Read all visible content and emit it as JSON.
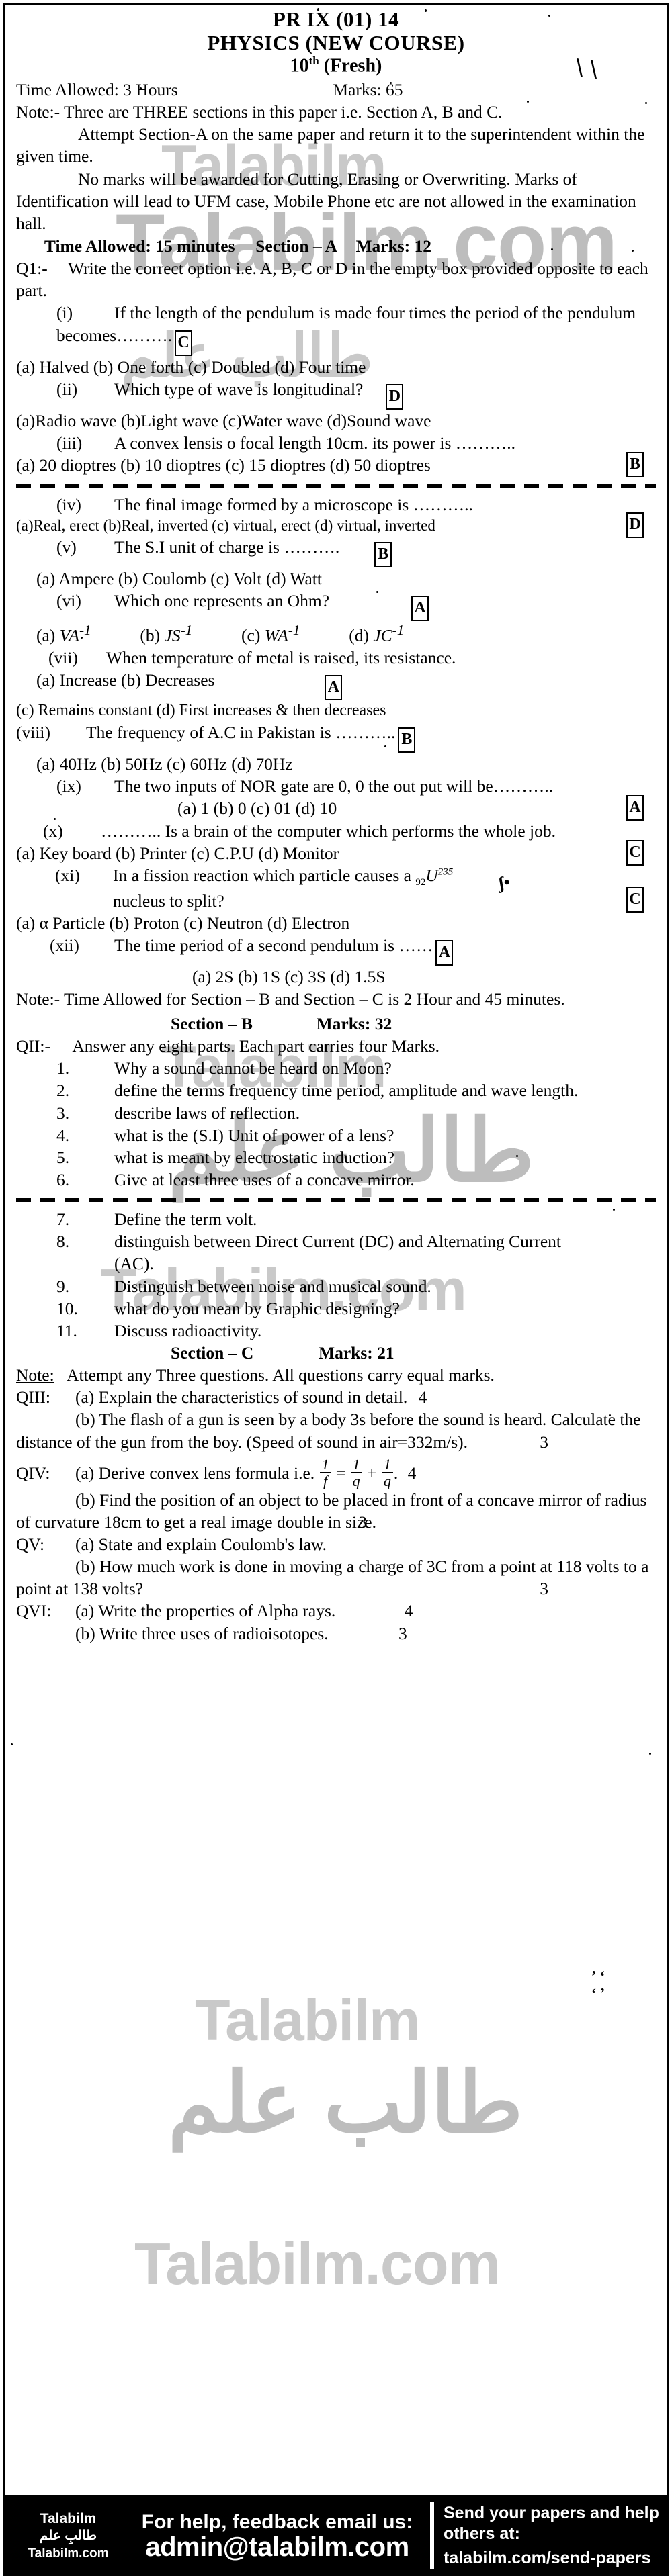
{
  "header": {
    "code": "PR IX (01) 14",
    "subject": "PHYSICS (NEW COURSE)",
    "class_num": "10",
    "class_sup": "th",
    "class_suffix": "(Fresh)",
    "hand_mark": "\\ \\",
    "time_allowed": "Time Allowed: 3 Hours",
    "marks": "Marks: 65"
  },
  "notes": {
    "note1": "Note:- Three are THREE sections in this paper i.e. Section A, B and C.",
    "para1": "Attempt Section-A on the same paper and return it to the superintendent within the given time.",
    "para2": "No marks will be awarded for Cutting, Erasing or Overwriting. Marks of Identification will lead to UFM case, Mobile Phone etc are not allowed in the examination hall."
  },
  "section_a": {
    "time_allowed": "Time Allowed: 15 minutes",
    "title": "Section – A",
    "marks": "Marks: 12",
    "q1_label": "Q1:-",
    "q1_text": "Write the correct option i.e. A, B, C or D in the empty box provided opposite to each part.",
    "mcqs": [
      {
        "num": "(i)",
        "stem": "If the length of the pendulum is made four times the period of the pendulum becomes……….",
        "answer": "C",
        "options": "(a) Halved        (b) One forth  (c) Doubled     (d) Four time"
      },
      {
        "num": "(ii)",
        "stem": "Which type of wave is longitudinal?",
        "answer": "D",
        "options": "(a)Radio wave (b)Light wave (c)Water wave (d)Sound wave"
      },
      {
        "num": "(iii)",
        "stem": "A convex lensis o focal length 10cm. its power is ………..",
        "answer": "B",
        "options": "(a) 20 dioptres (b) 10 dioptres  (c) 15 dioptres  (d) 50 dioptres"
      },
      {
        "num": "(iv)",
        "stem": "The final image formed by a microscope is ………..",
        "answer": "D",
        "options": "(a)Real, erect  (b)Real, inverted  (c) virtual, erect (d) virtual, inverted"
      },
      {
        "num": "(v)",
        "stem": "The S.I unit of charge is ……….",
        "answer": "B",
        "options": "(a) Ampere     (b) Coulomb   (c) Volt          (d) Watt"
      },
      {
        "num": "(vi)",
        "stem": "Which one represents an Ohm?",
        "answer": "A",
        "options_math": true
      },
      {
        "num": "(vii)",
        "stem": "When temperature of metal is raised, its resistance.",
        "answer": "A",
        "options": "(a) Increase          (b) Decreases",
        "options2": "(c) Remains constant  (d) First increases & then decreases"
      },
      {
        "num": "(viii)",
        "stem": "The frequency of A.C in Pakistan is ………..",
        "answer": "B",
        "options": "(a) 40Hz       (b) 50Hz       (c) 60Hz        (d) 70Hz"
      },
      {
        "num": "(ix)",
        "stem": "The two inputs of NOR gate are 0, 0 the out put will be………..",
        "answer": "A",
        "options": "(a) 1   (b) 0   (c) 01  (d) 10"
      },
      {
        "num": "(x)",
        "stem": "……….. Is a brain of the computer which performs the whole job.",
        "answer": "C",
        "options": "(a) Key board (b) Printer      (c) C.P.U        (d) Monitor"
      },
      {
        "num": "(xi)",
        "stem": "In a fission reaction which particle causes a",
        "stem_tail": "nucleus to split?",
        "answer": "C",
        "options": "(a) α  Particle (b) Proton      (c) Neutron     (d) Electron"
      },
      {
        "num": "(xii)",
        "stem": "The time period of a second pendulum is ……",
        "answer": "A",
        "options": "(a) 2S  (b) 1S  (c) 3S  (d) 1.5S"
      }
    ],
    "uranium": {
      "sub": "92",
      "sym": "U",
      "sup": "235"
    },
    "ohm_options": [
      {
        "label": "(a)",
        "sym": "VA",
        "exp": "-1"
      },
      {
        "label": "(b)",
        "sym": "JS",
        "exp": "-1"
      },
      {
        "label": "(c)",
        "sym": "WA",
        "exp": "-1"
      },
      {
        "label": "(d)",
        "sym": "JC",
        "exp": "-1"
      }
    ],
    "note_time": "Note:- Time Allowed for Section – B and Section – C is 2 Hour and 45 minutes."
  },
  "section_b": {
    "title": "Section – B",
    "marks": "Marks: 32",
    "q2_label": "QII:-",
    "q2_text": "Answer any eight parts. Each part carries four Marks.",
    "parts": [
      {
        "num": "1.",
        "text": "Why a sound cannot be heard on Moon?"
      },
      {
        "num": "2.",
        "text": "define the terms frequency time period, amplitude and wave length."
      },
      {
        "num": "3.",
        "text": "describe laws of reflection."
      },
      {
        "num": "4.",
        "text": "what is the (S.I) Unit of power of a lens?"
      },
      {
        "num": "5.",
        "text": "what is meant by electrostatic induction?"
      },
      {
        "num": "6.",
        "text": "Give at least three uses of a concave mirror."
      },
      {
        "num": "7.",
        "text": "Define the term volt."
      },
      {
        "num": "8.",
        "text": "distinguish between Direct Current (DC) and Alternating Current (AC)."
      },
      {
        "num": "9.",
        "text": "Distinguish between noise and musical sound."
      },
      {
        "num": "10.",
        "text": "what do you mean by Graphic designing?"
      },
      {
        "num": "11.",
        "text": "Discuss radioactivity."
      }
    ]
  },
  "section_c": {
    "title": "Section – C",
    "marks": "Marks: 21",
    "note_label": "Note:",
    "note_text": "Attempt any Three questions. All questions carry equal marks.",
    "questions": [
      {
        "label": "QIII:",
        "parts": [
          {
            "text": "(a) Explain the characteristics of sound in detail.",
            "marks": "4"
          },
          {
            "text": "(b) The flash of a gun is seen by a body 3s before the sound is heard. Calculate the distance of the gun from the boy. (Speed of sound in air=332m/s).",
            "marks": "3"
          }
        ]
      },
      {
        "label": "QIV:",
        "parts": [
          {
            "text": "(a) Derive convex lens formula i.e.",
            "formula": true,
            "marks": "4"
          },
          {
            "text": "(b) Find the position of an object to be placed in front of a concave mirror of radius of curvature 18cm to get a real image double in size.",
            "marks": "3"
          }
        ]
      },
      {
        "label": "QV:",
        "parts": [
          {
            "text": "(a) State and explain Coulomb's law.",
            "marks": ""
          },
          {
            "text": "(b) How much work is done in moving a charge of 3C from a point at 118 volts to a point at 138 volts?",
            "marks": "3"
          }
        ]
      },
      {
        "label": "QVI:",
        "parts": [
          {
            "text": "(a) Write the properties of Alpha rays.",
            "marks": "4"
          },
          {
            "text": "(b) Write three uses of radioisotopes.",
            "marks": "3"
          }
        ]
      }
    ],
    "lens_formula": {
      "n1": "1",
      "d1": "f",
      "eq": "=",
      "n2": "1",
      "d2": "q",
      "plus": "+",
      "n3": "1",
      "d3": "q",
      "trail": "."
    }
  },
  "watermark": {
    "word": "Talabilm",
    "dotcom": "Talabilm.com",
    "urdu": "طالب علم"
  },
  "footer": {
    "brand_name": "Talabilm",
    "brand_urdu": "طالبِ علم",
    "brand_site": "Talabilm.com",
    "help_line": "For help, feedback email us:",
    "email": "admin@talabilm.com",
    "send_line1": "Send your papers and help",
    "send_line2": "others at:",
    "send_url": "talabilm.com/send-papers"
  }
}
